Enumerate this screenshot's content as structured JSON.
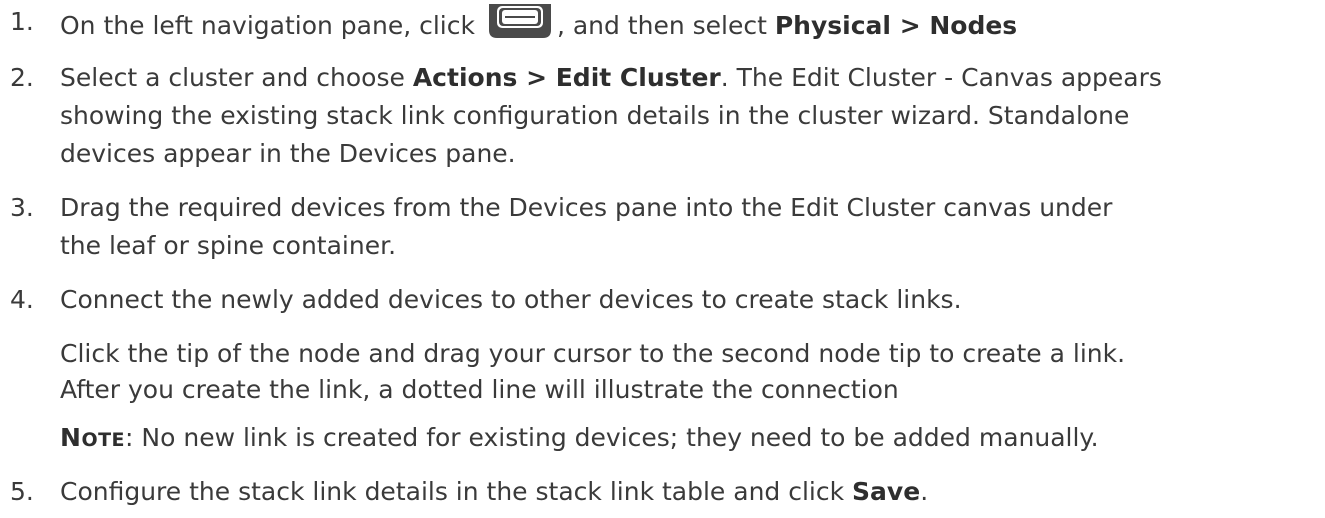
{
  "steps": [
    {
      "num": "1.",
      "pre": "On the left navigation pane, click",
      "icon": "server-icon",
      "mid": ", and then select ",
      "bold": "Physical > Nodes"
    },
    {
      "num": "2.",
      "pre": "Select a cluster and choose ",
      "bold": "Actions > Edit Cluster",
      "post": ". The Edit Cluster - Canvas appears",
      "line2": "showing the existing stack link configuration details in the cluster wizard. Standalone",
      "line3": "devices appear in the Devices pane."
    },
    {
      "num": "3.",
      "line1": "Drag the required devices from the Devices pane into the Edit Cluster canvas under",
      "line2": "the leaf or spine container."
    },
    {
      "num": "4.",
      "line1": "Connect the newly added devices to other devices to create stack links.",
      "para1": "Click the tip of the node and drag your cursor to the second node tip to create a link.",
      "para2": "After you create the link, a dotted line will illustrate the connection",
      "note_first": "N",
      "note_rest": "OTE",
      "note_text": ": No new link is created for existing devices; they need to be added manually."
    },
    {
      "num": "5.",
      "pre": "Configure the stack link details in the stack link table and click ",
      "bold": "Save",
      "post": "."
    }
  ]
}
